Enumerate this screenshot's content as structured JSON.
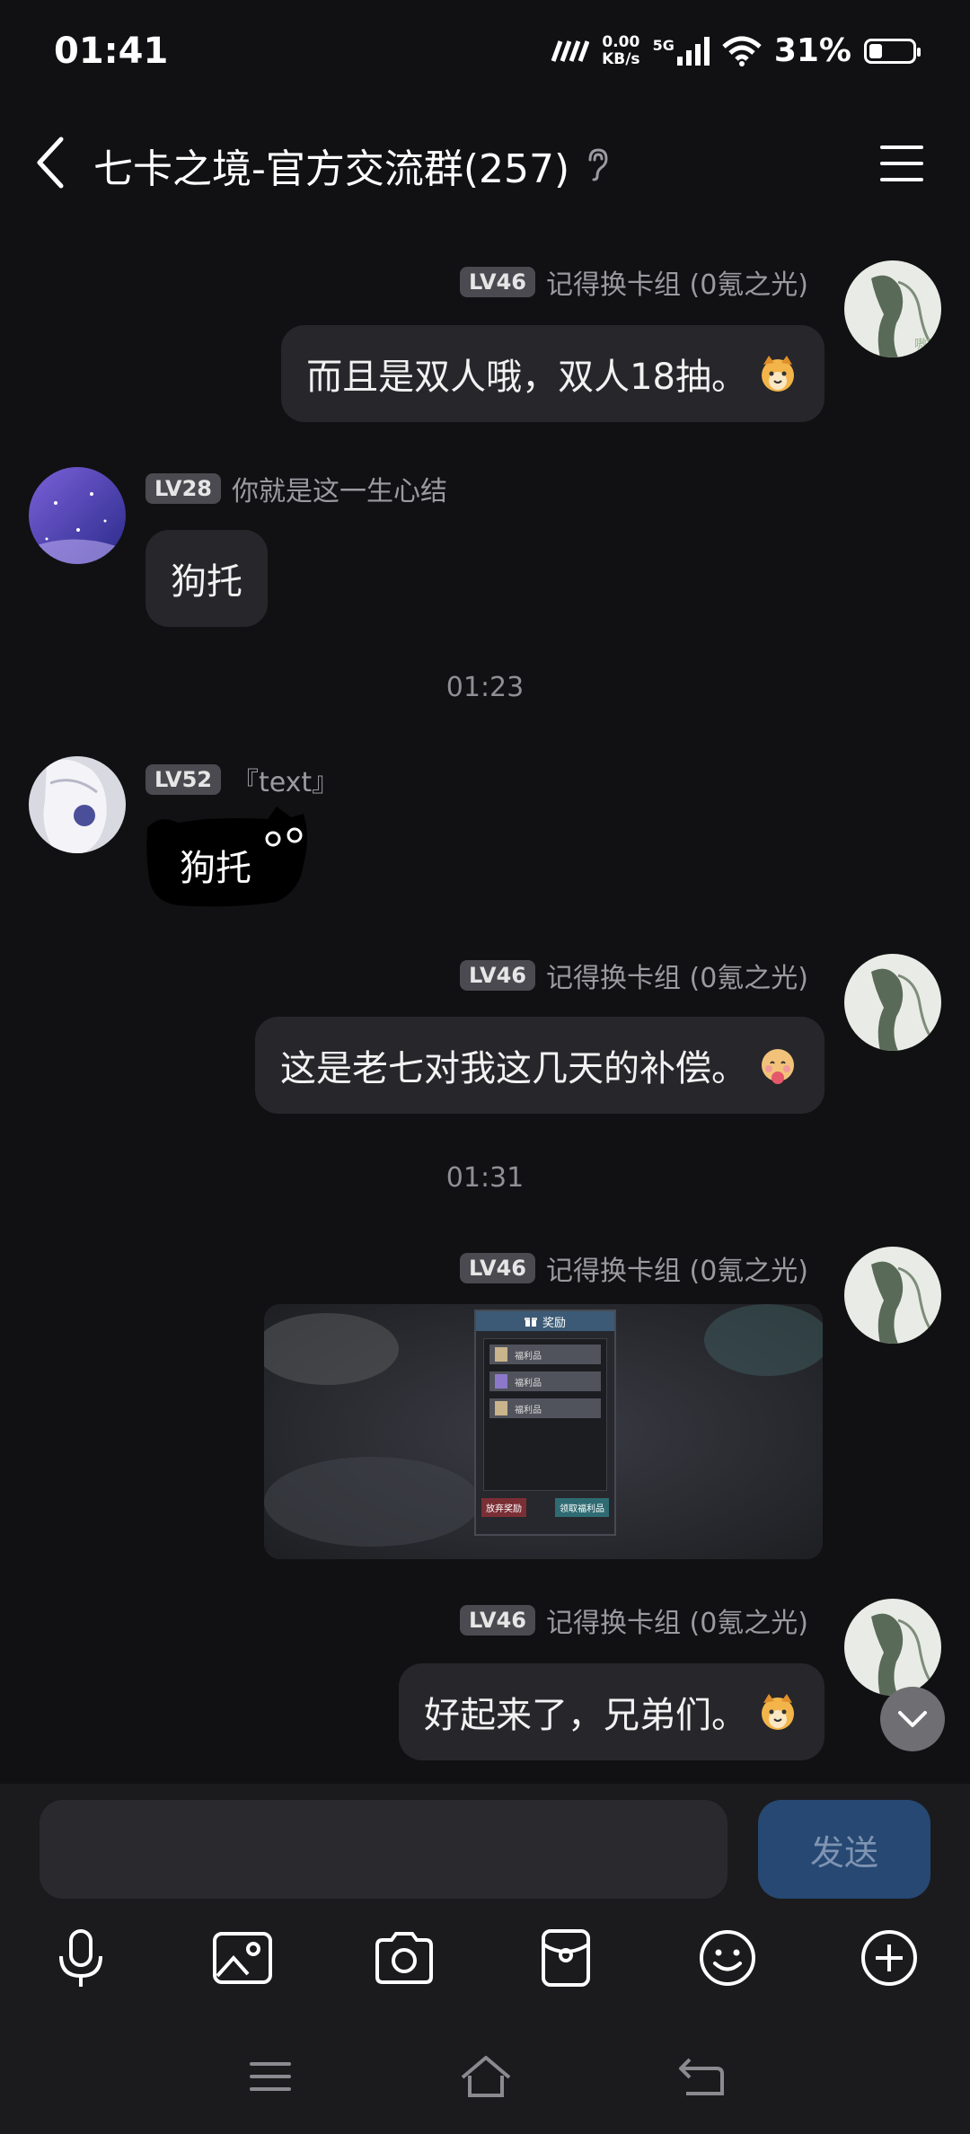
{
  "status_bar": {
    "time": "01:41",
    "net_speed_value": "0.00",
    "net_speed_unit": "KB/s",
    "network_type": "5G",
    "battery_percent": "31%",
    "battery_level": 0.31
  },
  "header": {
    "title": "七卡之境-官方交流群(257)"
  },
  "messages": [
    {
      "side": "right",
      "level": "LV46",
      "sender": "记得换卡组 (0氪之光)",
      "text": "而且是双人哦，双人18抽。"
    },
    {
      "side": "left",
      "level": "LV28",
      "sender": "你就是这一生心结",
      "text": "狗托"
    },
    {
      "side": "left",
      "level": "LV52",
      "sender": "『text』",
      "text": "狗托"
    },
    {
      "side": "right",
      "level": "LV46",
      "sender": "记得换卡组 (0氪之光)",
      "text": "这是老七对我这几天的补偿。"
    },
    {
      "side": "right",
      "level": "LV46",
      "sender": "记得换卡组 (0氪之光)",
      "image": {
        "dialog_title": "奖励",
        "items": [
          "福利品",
          "福利品",
          "福利品"
        ],
        "left_button": "放弃奖励",
        "right_button": "领取福利品"
      }
    },
    {
      "side": "right",
      "level": "LV46",
      "sender": "记得换卡组 (0氪之光)",
      "text": "好起来了，兄弟们。"
    }
  ],
  "time_separators": [
    "01:23",
    "01:31"
  ],
  "input": {
    "placeholder": "",
    "send_label": "发送"
  },
  "toolbar": [
    "microphone-icon",
    "image-icon",
    "camera-icon",
    "red-packet-icon",
    "emoji-icon",
    "plus-icon"
  ],
  "colors": {
    "background": "#111113",
    "bubble": "#27272b",
    "send_button": "#264873",
    "level_badge": "#4a4a50"
  }
}
